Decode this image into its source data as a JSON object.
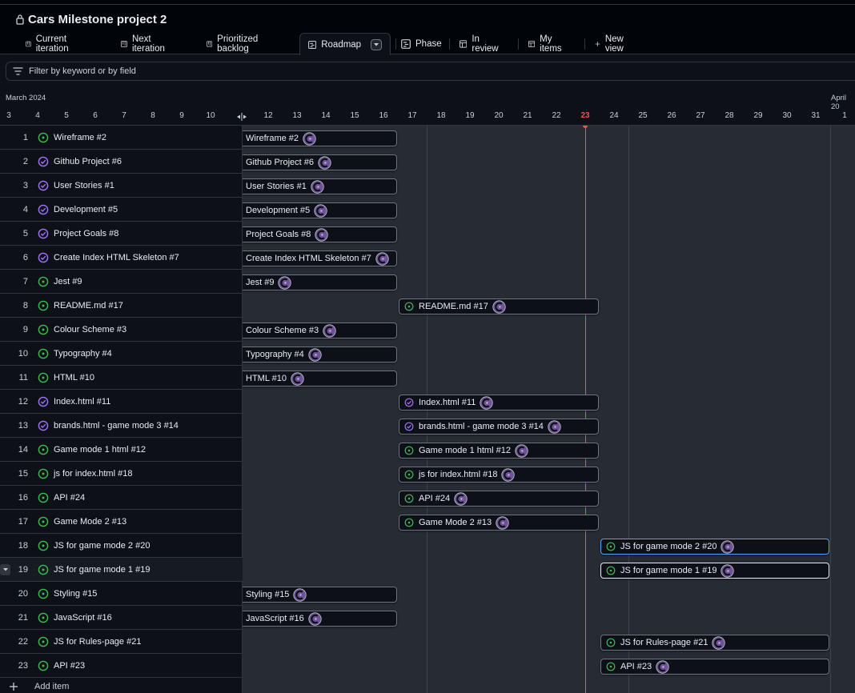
{
  "project": {
    "title": "Cars Milestone project 2"
  },
  "tabs": [
    {
      "label": "Current iteration",
      "icon": "board-icon"
    },
    {
      "label": "Next iteration",
      "icon": "board-icon"
    },
    {
      "label": "Prioritized backlog",
      "icon": "board-icon"
    },
    {
      "label": "Roadmap",
      "icon": "roadmap-icon",
      "active": true
    },
    {
      "label": "Phase",
      "icon": "roadmap-icon"
    },
    {
      "label": "In review",
      "icon": "table-icon"
    },
    {
      "label": "My items",
      "icon": "table-icon"
    },
    {
      "label": "New view",
      "icon": "plus-icon"
    }
  ],
  "filter": {
    "placeholder": "Filter by keyword or by field"
  },
  "timeline": {
    "month_start": "March 2024",
    "month_end": "April 20",
    "days": [
      "3",
      "4",
      "5",
      "6",
      "7",
      "8",
      "9",
      "10",
      "11",
      "12",
      "13",
      "14",
      "15",
      "16",
      "17",
      "18",
      "19",
      "20",
      "21",
      "22",
      "23",
      "24",
      "25",
      "26",
      "27",
      "28",
      "29",
      "30",
      "31",
      "1"
    ],
    "today": "23"
  },
  "colors": {
    "open": "#3fb950",
    "done": "#a371f7",
    "today": "#f85149",
    "selected_border": "#58a6ff"
  },
  "items": [
    {
      "num": "1",
      "title": "Wireframe  #2",
      "bar": "Wireframe #2",
      "status": "open",
      "start": "11",
      "end": "16"
    },
    {
      "num": "2",
      "title": "Github Project  #6",
      "bar": "Github Project #6",
      "status": "done",
      "start": "11",
      "end": "16"
    },
    {
      "num": "3",
      "title": "User Stories  #1",
      "bar": "User Stories #1",
      "status": "done",
      "start": "11",
      "end": "16"
    },
    {
      "num": "4",
      "title": "Development  #5",
      "bar": "Development #5",
      "status": "done",
      "start": "11",
      "end": "16"
    },
    {
      "num": "5",
      "title": "Project Goals  #8",
      "bar": "Project Goals #8",
      "status": "done",
      "start": "11",
      "end": "16"
    },
    {
      "num": "6",
      "title": "Create Index HTML Skeleton  #7",
      "bar": "Create Index HTML Skeleton #7",
      "status": "done",
      "start": "11",
      "end": "16"
    },
    {
      "num": "7",
      "title": "Jest  #9",
      "bar": "Jest #9",
      "status": "open",
      "start": "11",
      "end": "16"
    },
    {
      "num": "8",
      "title": "README.md  #17",
      "bar": "README.md #17",
      "status": "open",
      "start": "17",
      "end": "23"
    },
    {
      "num": "9",
      "title": "Colour Scheme  #3",
      "bar": "Colour Scheme #3",
      "status": "open",
      "start": "11",
      "end": "16"
    },
    {
      "num": "10",
      "title": "Typography  #4",
      "bar": "Typography #4",
      "status": "open",
      "start": "11",
      "end": "16"
    },
    {
      "num": "11",
      "title": "HTML  #10",
      "bar": "HTML #10",
      "status": "open",
      "start": "11",
      "end": "16"
    },
    {
      "num": "12",
      "title": "Index.html  #11",
      "bar": "Index.html #11",
      "status": "done",
      "start": "17",
      "end": "23"
    },
    {
      "num": "13",
      "title": "brands.html - game mode 3  #14",
      "bar": "brands.html - game mode 3 #14",
      "status": "done",
      "start": "17",
      "end": "23"
    },
    {
      "num": "14",
      "title": "Game mode 1 html  #12",
      "bar": "Game mode 1 html #12",
      "status": "open",
      "start": "17",
      "end": "23"
    },
    {
      "num": "15",
      "title": "js for index.html  #18",
      "bar": "js for index.html #18",
      "status": "open",
      "start": "17",
      "end": "23"
    },
    {
      "num": "16",
      "title": "API  #24",
      "bar": "API #24",
      "status": "open",
      "start": "17",
      "end": "23"
    },
    {
      "num": "17",
      "title": "Game Mode 2  #13",
      "bar": "Game Mode 2 #13",
      "status": "open",
      "start": "17",
      "end": "23"
    },
    {
      "num": "18",
      "title": "JS for game mode 2  #20",
      "bar": "JS for game mode 2 #20",
      "status": "open",
      "start": "24",
      "end": "31",
      "style": "hl"
    },
    {
      "num": "19",
      "title": "JS for game mode 1  #19",
      "bar": "JS for game mode 1 #19",
      "status": "open",
      "start": "24",
      "end": "31",
      "style": "white",
      "selected": true
    },
    {
      "num": "20",
      "title": "Styling  #15",
      "bar": "Styling #15",
      "status": "open",
      "start": "11",
      "end": "16"
    },
    {
      "num": "21",
      "title": "JavaScript  #16",
      "bar": "JavaScript #16",
      "status": "open",
      "start": "11",
      "end": "16"
    },
    {
      "num": "22",
      "title": "JS for Rules-page  #21",
      "bar": "JS for Rules-page #21",
      "status": "open",
      "start": "24",
      "end": "31"
    },
    {
      "num": "23",
      "title": "API  #23",
      "bar": "API #23",
      "status": "open",
      "start": "24",
      "end": "31"
    }
  ],
  "add_item": {
    "label": "Add item"
  }
}
